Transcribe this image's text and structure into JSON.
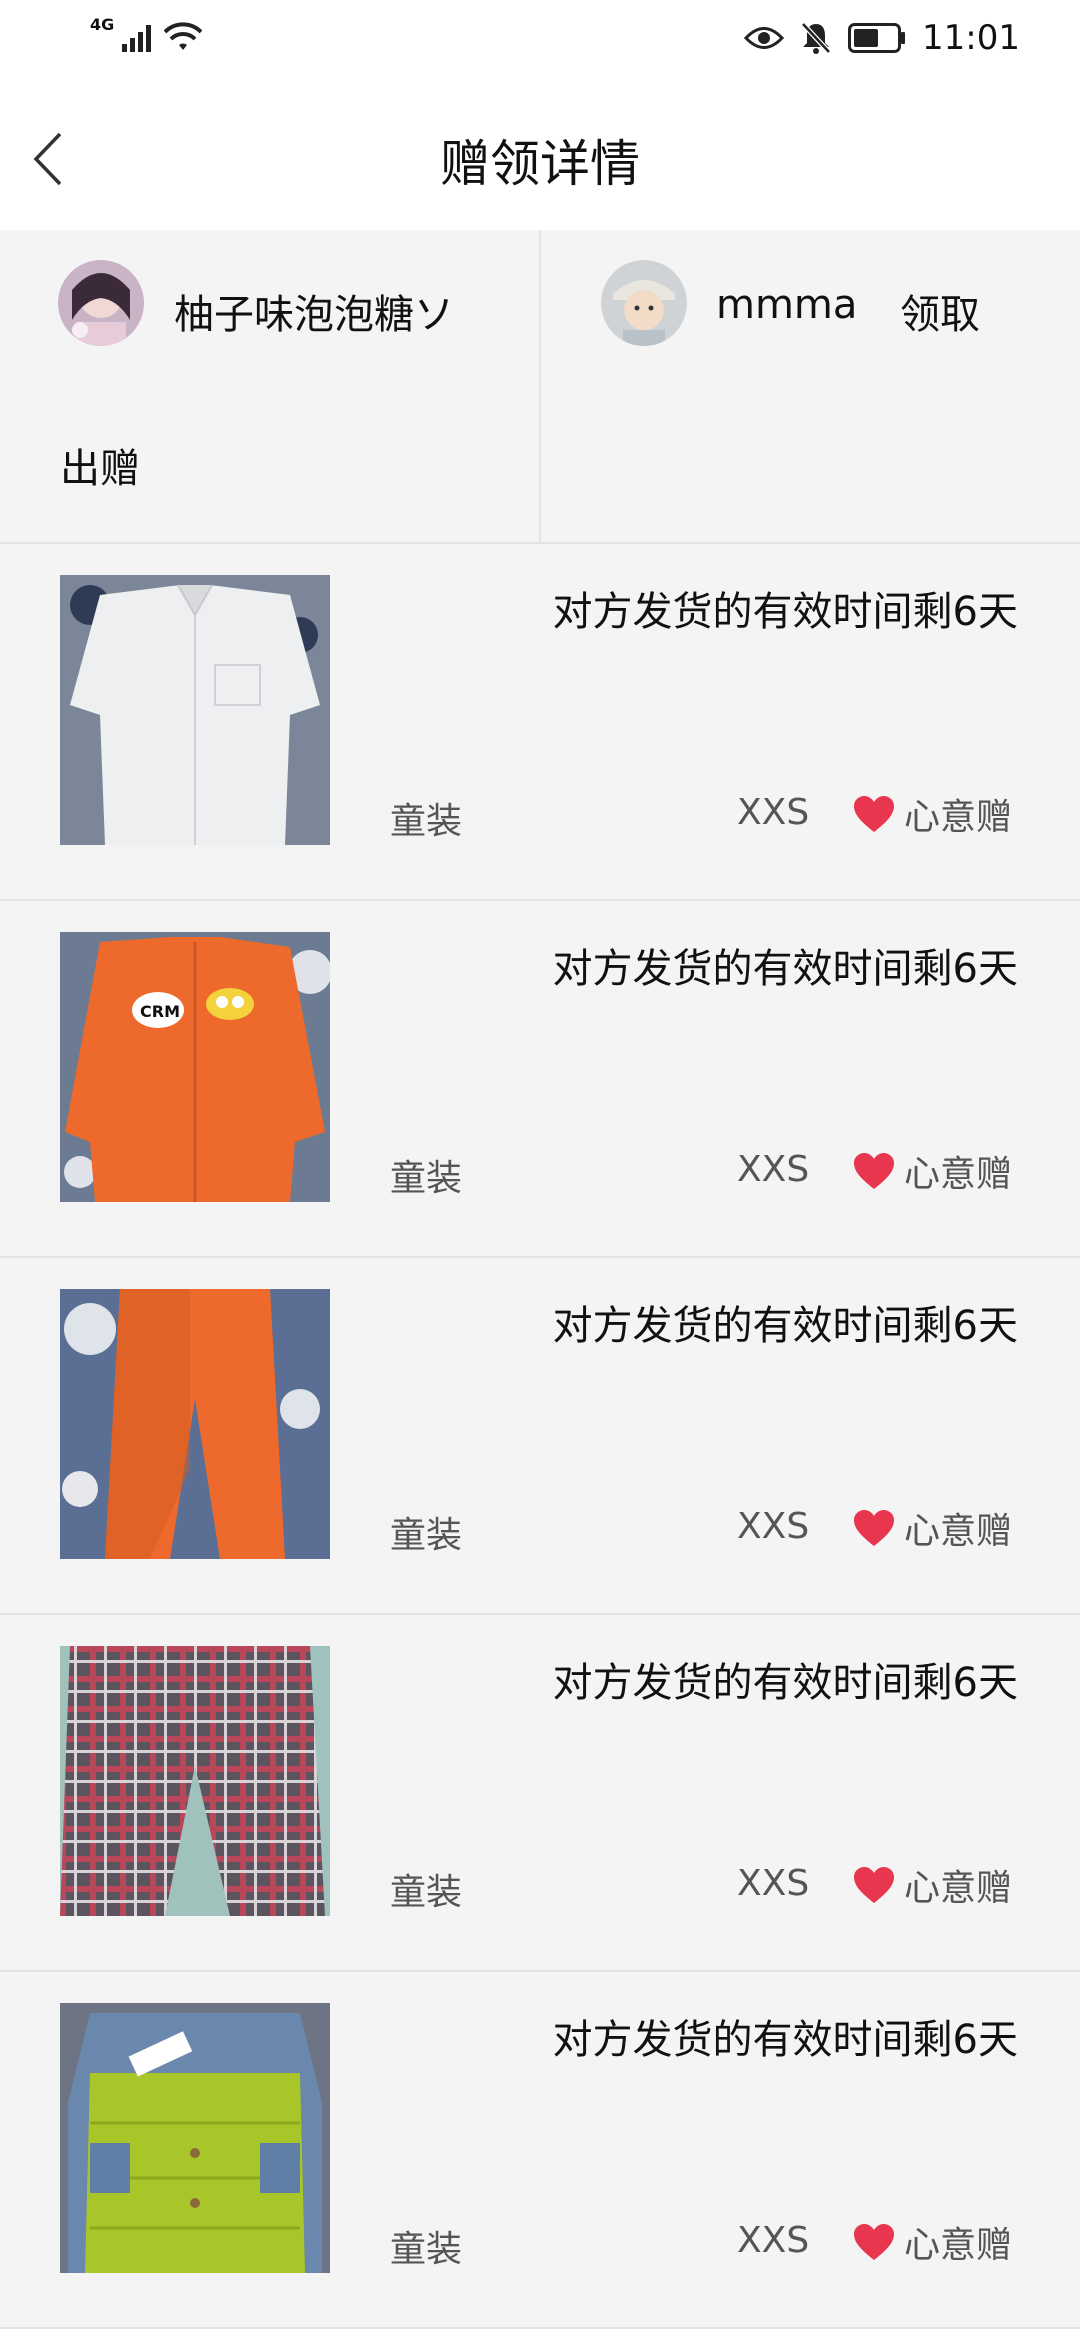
{
  "status_bar": {
    "network": "4G",
    "time": "11:01",
    "icons": [
      "signal-icon",
      "wifi-icon",
      "eye-icon",
      "bell-off-icon",
      "battery-icon"
    ]
  },
  "header": {
    "title": "赠领详情",
    "back_icon": "chevron-left-icon"
  },
  "users": {
    "giver": {
      "name": "柚子味泡泡糖ソ",
      "role": "出赠"
    },
    "receiver": {
      "name": "mmma",
      "role": "领取"
    }
  },
  "items": [
    {
      "deadline": "对方发货的有效时间剩6天",
      "category": "童装",
      "size": "XXS",
      "tag": "心意赠",
      "image": "white-shirt"
    },
    {
      "deadline": "对方发货的有效时间剩6天",
      "category": "童装",
      "size": "XXS",
      "tag": "心意赠",
      "image": "orange-jacket"
    },
    {
      "deadline": "对方发货的有效时间剩6天",
      "category": "童装",
      "size": "XXS",
      "tag": "心意赠",
      "image": "orange-pants"
    },
    {
      "deadline": "对方发货的有效时间剩6天",
      "category": "童装",
      "size": "XXS",
      "tag": "心意赠",
      "image": "plaid-pants"
    },
    {
      "deadline": "对方发货的有效时间剩6天",
      "category": "童装",
      "size": "XXS",
      "tag": "心意赠",
      "image": "denim-puffer-jacket"
    }
  ],
  "colors": {
    "heart": "#e8364f",
    "panel_bg": "#f4f4f4",
    "divider": "#e3e3e3",
    "secondary_text": "#555555"
  }
}
